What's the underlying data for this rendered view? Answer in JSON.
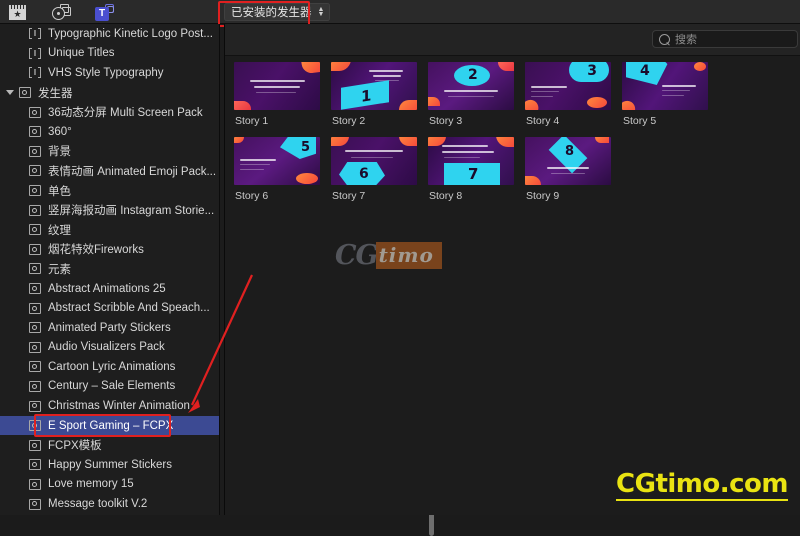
{
  "app": {
    "name": "Final Cut Pro — Titles and Generators Browser",
    "accent_selection": "#3c4a93",
    "annotation_color": "#e02020"
  },
  "toolbar": {
    "icons": [
      {
        "name": "titles-browser-icon",
        "label": "Titles"
      },
      {
        "name": "photos-audio-browser-icon",
        "label": "Photos and Audio"
      },
      {
        "name": "titles-generators-browser-icon",
        "label": "Titles and Generators",
        "active": true
      }
    ],
    "dropdown": {
      "label": "已安装的发生器",
      "chevron": "⌃⌄"
    }
  },
  "search": {
    "placeholder": "搜索",
    "value": "",
    "icon": "search-icon"
  },
  "sidebar": {
    "scrollbar": {
      "visible": true
    },
    "items": [
      {
        "label": "Typographic Kinetic Logo Post...",
        "icon": "title-icon",
        "indent": 2,
        "type": "item"
      },
      {
        "label": "Unique Titles",
        "icon": "title-icon",
        "indent": 2,
        "type": "item"
      },
      {
        "label": "VHS Style Typography",
        "icon": "title-icon",
        "indent": 2,
        "type": "item"
      },
      {
        "label": "发生器",
        "icon": "generator-icon",
        "indent": 0,
        "type": "group",
        "expanded": true
      },
      {
        "label": "36动态分屏 Multi Screen Pack",
        "icon": "generator-icon",
        "indent": 2,
        "type": "item"
      },
      {
        "label": "360°",
        "icon": "generator-icon",
        "indent": 2,
        "type": "item"
      },
      {
        "label": "背景",
        "icon": "generator-icon",
        "indent": 2,
        "type": "item"
      },
      {
        "label": "表情动画 Animated Emoji Pack...",
        "icon": "generator-icon",
        "indent": 2,
        "type": "item"
      },
      {
        "label": "单色",
        "icon": "generator-icon",
        "indent": 2,
        "type": "item"
      },
      {
        "label": "竖屏海报动画 Instagram Storie...",
        "icon": "generator-icon",
        "indent": 2,
        "type": "item"
      },
      {
        "label": "纹理",
        "icon": "generator-icon",
        "indent": 2,
        "type": "item"
      },
      {
        "label": "烟花特效Fireworks",
        "icon": "generator-icon",
        "indent": 2,
        "type": "item"
      },
      {
        "label": "元素",
        "icon": "generator-icon",
        "indent": 2,
        "type": "item"
      },
      {
        "label": "Abstract Animations 25",
        "icon": "generator-icon",
        "indent": 2,
        "type": "item"
      },
      {
        "label": "Abstract Scribble And Speach...",
        "icon": "generator-icon",
        "indent": 2,
        "type": "item"
      },
      {
        "label": "Animated Party Stickers",
        "icon": "generator-icon",
        "indent": 2,
        "type": "item"
      },
      {
        "label": "Audio Visualizers Pack",
        "icon": "generator-icon",
        "indent": 2,
        "type": "item"
      },
      {
        "label": "Cartoon Lyric Animations",
        "icon": "generator-icon",
        "indent": 2,
        "type": "item"
      },
      {
        "label": "Century – Sale Elements",
        "icon": "generator-icon",
        "indent": 2,
        "type": "item"
      },
      {
        "label": "Christmas Winter Animation",
        "icon": "generator-icon",
        "indent": 2,
        "type": "item"
      },
      {
        "label": "E Sport Gaming – FCPX",
        "icon": "generator-icon",
        "indent": 2,
        "type": "item",
        "selected": true
      },
      {
        "label": "FCPX模板",
        "icon": "generator-icon",
        "indent": 2,
        "type": "item"
      },
      {
        "label": "Happy Summer Stickers",
        "icon": "generator-icon",
        "indent": 2,
        "type": "item"
      },
      {
        "label": "Love memory 15",
        "icon": "generator-icon",
        "indent": 2,
        "type": "item"
      },
      {
        "label": "Message toolkit V.2",
        "icon": "generator-icon",
        "indent": 2,
        "type": "item"
      }
    ]
  },
  "browser": {
    "items": [
      {
        "caption": "Story 1",
        "art": "a1",
        "headline": "Tournament E-Sports",
        "number": ""
      },
      {
        "caption": "Story 2",
        "art": "a2",
        "headline": "Let's Start The Game",
        "number": "1"
      },
      {
        "caption": "Story 3",
        "art": "a3",
        "headline": "Online Esport",
        "number": "2"
      },
      {
        "caption": "Story 4",
        "art": "a4",
        "headline": "Having Fun Enjoy",
        "number": "3"
      },
      {
        "caption": "Story 5",
        "art": "a5",
        "headline": "How It Is Working",
        "number": "4"
      },
      {
        "caption": "Story 6",
        "art": "a6",
        "headline": "Explore The Future",
        "number": "5"
      },
      {
        "caption": "Story 7",
        "art": "a7",
        "headline": "Play Together",
        "number": "6"
      },
      {
        "caption": "Story 8",
        "art": "a8",
        "headline": "You're The Champion",
        "number": "7"
      },
      {
        "caption": "Story 9",
        "art": "a9",
        "headline": "Join Now",
        "number": "8"
      }
    ]
  },
  "watermarks": {
    "center": {
      "cg": "CG",
      "timo": "timo"
    },
    "bottom_right": {
      "text": "CGtimo.com",
      "color": "#e9e312"
    }
  },
  "annotations": {
    "dropdown_box": "已安装的发生器",
    "selected_item_box": "E Sport Gaming – FCPX",
    "arrow": "points from browser area to selected sidebar item"
  }
}
